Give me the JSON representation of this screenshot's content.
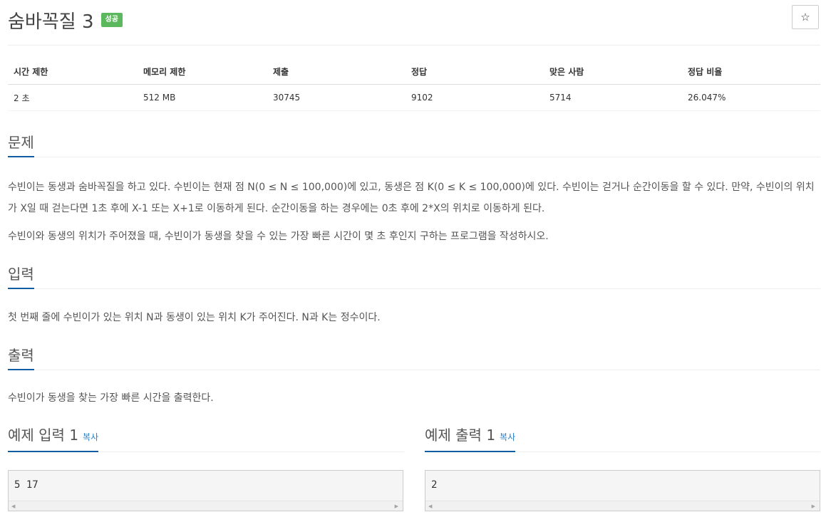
{
  "header": {
    "title": "숨바꼭질 3",
    "badge": "성공",
    "star_icon": "☆"
  },
  "info_table": {
    "headers": [
      "시간 제한",
      "메모리 제한",
      "제출",
      "정답",
      "맞은 사람",
      "정답 비율"
    ],
    "values": [
      "2 초",
      "512 MB",
      "30745",
      "9102",
      "5714",
      "26.047%"
    ]
  },
  "sections": {
    "problem": {
      "title": "문제",
      "paragraph1": "수빈이는 동생과 숨바꼭질을 하고 있다. 수빈이는 현재 점 N(0 ≤ N ≤ 100,000)에 있고, 동생은 점 K(0 ≤ K ≤ 100,000)에 있다. 수빈이는 걷거나 순간이동을 할 수 있다. 만약, 수빈이의 위치가 X일 때 걷는다면 1초 후에 X-1 또는 X+1로 이동하게 된다. 순간이동을 하는 경우에는 0초 후에 2*X의 위치로 이동하게 된다.",
      "paragraph2": "수빈이와 동생의 위치가 주어졌을 때, 수빈이가 동생을 찾을 수 있는 가장 빠른 시간이 몇 초 후인지 구하는 프로그램을 작성하시오."
    },
    "input": {
      "title": "입력",
      "paragraph": "첫 번째 줄에 수빈이가 있는 위치 N과 동생이 있는 위치 K가 주어진다. N과 K는 정수이다."
    },
    "output": {
      "title": "출력",
      "paragraph": "수빈이가 동생을 찾는 가장 빠른 시간을 출력한다."
    }
  },
  "samples": {
    "input": {
      "title": "예제 입력 1",
      "copy_label": "복사",
      "content": "5 17"
    },
    "output": {
      "title": "예제 출력 1",
      "copy_label": "복사",
      "content": "2"
    }
  },
  "scroll": {
    "left_arrow": "◀",
    "right_arrow": "▶"
  },
  "colors": {
    "badge_success": "#5cb85c",
    "accent_underline": "#0f5ea3",
    "link": "#2a7fc4"
  }
}
